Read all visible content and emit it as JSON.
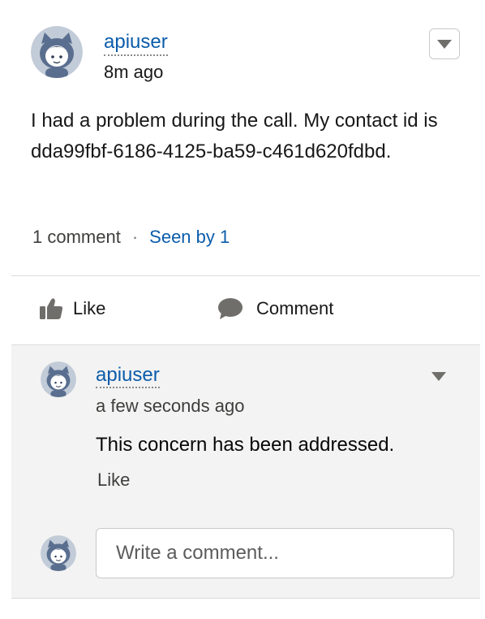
{
  "post": {
    "author": "apiuser",
    "time": "8m ago",
    "body": "I had a problem during the call. My contact id is dda99fbf-6186-4125-ba59-c461d620fdbd.",
    "comment_count": "1 comment",
    "separator": "·",
    "seen_by": "Seen by 1"
  },
  "actions": {
    "like": "Like",
    "comment": "Comment"
  },
  "comment": {
    "author": "apiuser",
    "time": "a few seconds ago",
    "text": "This concern has been addressed.",
    "like": "Like"
  },
  "composer": {
    "placeholder": "Write a comment..."
  },
  "icons": {
    "avatar": "astro-avatar-icon",
    "menu": "chevron-down-icon",
    "like": "thumbs-up-icon",
    "comment": "speech-bubble-icon"
  },
  "colors": {
    "link": "#0b5cab",
    "comments_bg": "#f3f3f3",
    "icon": "#706e6b"
  }
}
